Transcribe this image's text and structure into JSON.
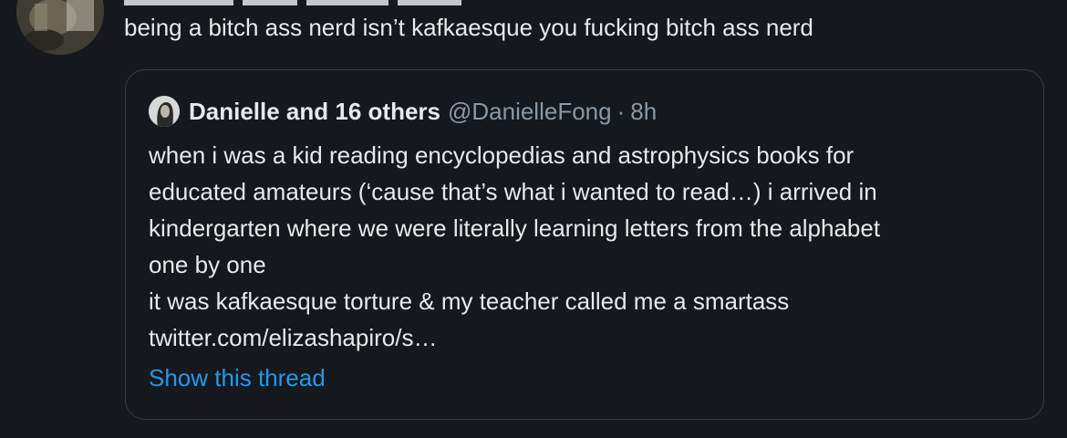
{
  "tweet": {
    "avatar_icon": "user-avatar-icon",
    "text": "being a bitch ass nerd isn’t kafkaesque you fucking bitch ass nerd"
  },
  "quote": {
    "avatar_icon": "quoted-user-avatar-icon",
    "name": "Danielle and 16 others",
    "handle": "@DanielleFong",
    "separator": "·",
    "time": "8h",
    "lines": [
      "when i was a kid reading encyclopedias and astrophysics books for",
      "educated amateurs (‘cause that’s what i wanted to read…) i arrived in",
      "kindergarten where we were literally learning letters from the alphabet",
      "one by one",
      "it was kafkaesque torture & my teacher called me a smartass",
      "twitter.com/elizashapiro/s…"
    ],
    "show_thread": "Show this thread"
  },
  "colors": {
    "background": "#15181c",
    "text": "#e7e9ea",
    "muted": "#8b98a5",
    "link": "#1d9bf0",
    "border": "#3a3f45"
  }
}
